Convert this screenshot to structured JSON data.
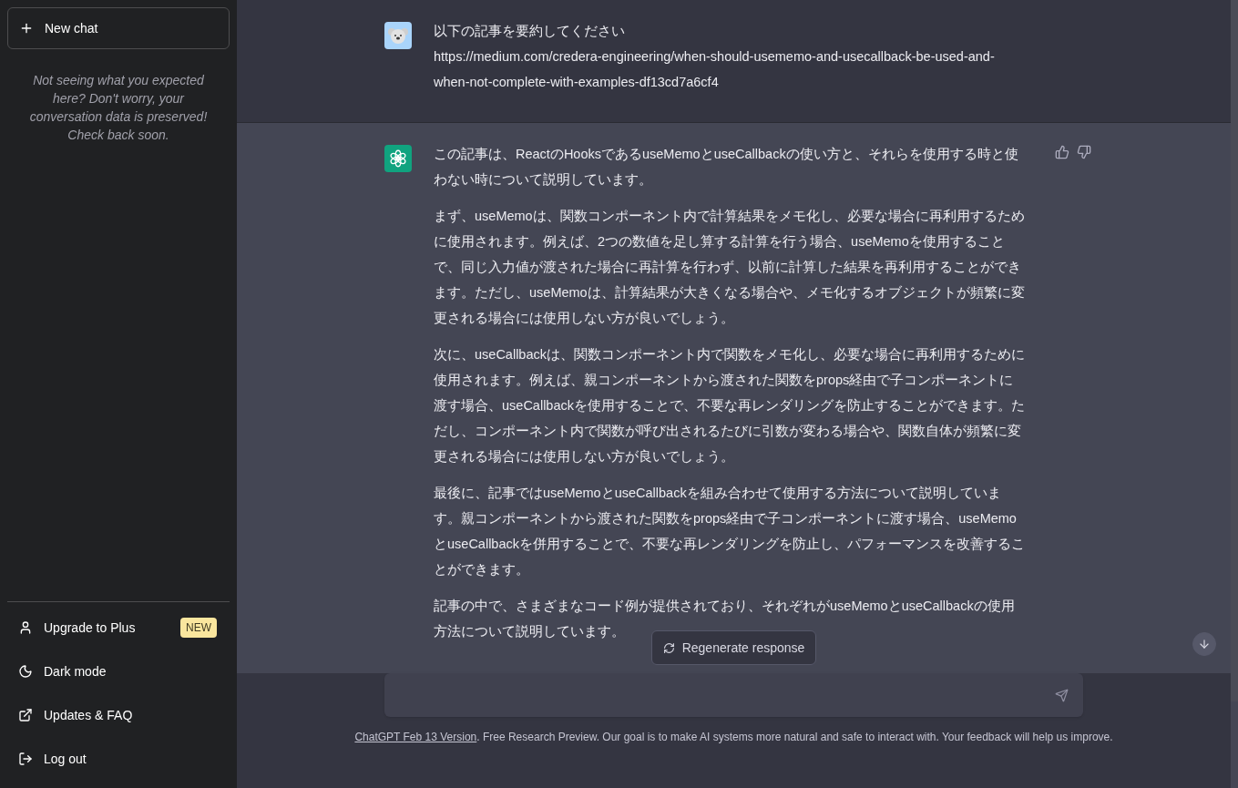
{
  "sidebar": {
    "new_chat_button": "New chat",
    "notice": "Not seeing what you expected here? Don't worry, your conversation data is preserved! Check back soon.",
    "menu": [
      {
        "label": "Upgrade to Plus",
        "badge": "NEW"
      },
      {
        "label": "Dark mode"
      },
      {
        "label": "Updates & FAQ"
      },
      {
        "label": "Log out"
      }
    ]
  },
  "messages": [
    {
      "kind": "user",
      "paragraphs": [
        "以下の記事を要約してください\nhttps://medium.com/credera-engineering/when-should-usememo-and-usecallback-be-used-and-when-not-complete-with-examples-df13cd7a6cf4"
      ]
    },
    {
      "kind": "assistant",
      "paragraphs": [
        "この記事は、ReactのHooksであるuseMemoとuseCallbackの使い方と、それらを使用する時と使わない時について説明しています。",
        "まず、useMemoは、関数コンポーネント内で計算結果をメモ化し、必要な場合に再利用するために使用されます。例えば、2つの数値を足し算する計算を行う場合、useMemoを使用することで、同じ入力値が渡された場合に再計算を行わず、以前に計算した結果を再利用することができます。ただし、useMemoは、計算結果が大きくなる場合や、メモ化するオブジェクトが頻繁に変更される場合には使用しない方が良いでしょう。",
        "次に、useCallbackは、関数コンポーネント内で関数をメモ化し、必要な場合に再利用するために使用されます。例えば、親コンポーネントから渡された関数をprops経由で子コンポーネントに渡す場合、useCallbackを使用することで、不要な再レンダリングを防止することができます。ただし、コンポーネント内で関数が呼び出されるたびに引数が変わる場合や、関数自体が頻繁に変更される場合には使用しない方が良いでしょう。",
        "最後に、記事ではuseMemoとuseCallbackを組み合わせて使用する方法について説明しています。親コンポーネントから渡された関数をprops経由で子コンポーネントに渡す場合、useMemoとuseCallbackを併用することで、不要な再レンダリングを防止し、パフォーマンスを改善することができます。",
        "記事の中で、さまざまなコード例が提供されており、それぞれがuseMemoとuseCallbackの使用方法について説明しています。"
      ]
    }
  ],
  "regenerate_button": "Regenerate response",
  "footer": {
    "link": "ChatGPT Feb 13 Version",
    "text": ". Free Research Preview. Our goal is to make AI systems more natural and safe to interact with. Your feedback will help us improve."
  }
}
